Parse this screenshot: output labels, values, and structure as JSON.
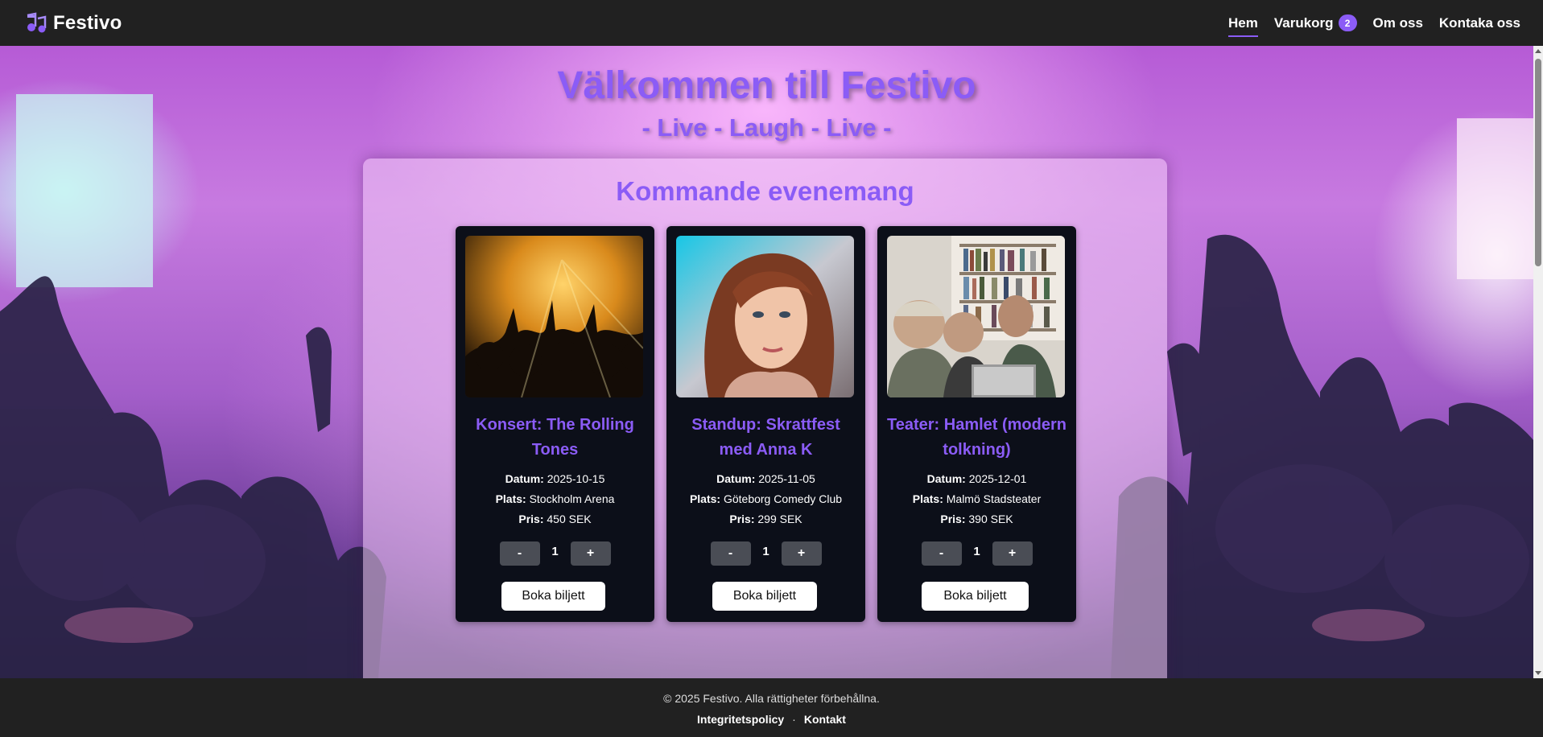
{
  "navbar": {
    "brand": "Festivo",
    "brand_icon": "music-note-icon",
    "links": [
      {
        "label": "Hem",
        "active": true
      },
      {
        "label": "Varukorg",
        "badge": "2"
      },
      {
        "label": "Om oss"
      },
      {
        "label": "Kontaka oss"
      }
    ]
  },
  "hero": {
    "title": "Välkommen till Festivo",
    "subtitle": "- Live - Laugh - Live -"
  },
  "events": {
    "heading": "Kommande evenemang",
    "date_label": "Datum:",
    "place_label": "Plats:",
    "price_label": "Pris:",
    "minus": "-",
    "plus": "+",
    "book_label": "Boka biljett",
    "items": [
      {
        "title": "Konsert: The Rolling Tones",
        "date": "2025-10-15",
        "place": "Stockholm Arena",
        "price": "450 SEK",
        "qty": "1",
        "image": "concert-crowd-image"
      },
      {
        "title": "Standup: Skrattfest med Anna K",
        "date": "2025-11-05",
        "place": "Göteborg Comedy Club",
        "price": "299 SEK",
        "qty": "1",
        "image": "woman-portrait-image"
      },
      {
        "title": "Teater: Hamlet (modern tolkning)",
        "date": "2025-12-01",
        "place": "Malmö Stadsteater",
        "price": "390 SEK",
        "qty": "1",
        "image": "people-at-laptop-image"
      }
    ]
  },
  "footer": {
    "copyright": "© 2025 Festivo. Alla rättigheter förbehållna.",
    "links": [
      "Integritetspolicy",
      "Kontakt"
    ],
    "separator": "·"
  },
  "colors": {
    "accent": "#8b5cf6",
    "nav_bg": "#212121",
    "card_bg": "#0c0f19"
  }
}
